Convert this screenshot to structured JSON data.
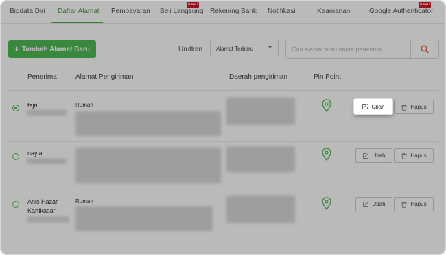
{
  "tabs": [
    {
      "label": "Biodata Diri",
      "active": false
    },
    {
      "label": "Daftar Alamat",
      "active": true
    },
    {
      "label": "Pembayaran",
      "active": false
    },
    {
      "label": "Beli Langsung",
      "active": false,
      "badge": "BARU"
    },
    {
      "label": "Rekening Bank",
      "active": false
    },
    {
      "label": "Notifikasi",
      "active": false
    },
    {
      "label": "Keamanan",
      "active": false
    },
    {
      "label": "Google Authenticator",
      "active": false,
      "badge": "BARU"
    }
  ],
  "toolbar": {
    "add_label": "Tambah Alamat Baru",
    "sort_label": "Urutkan",
    "sort_value": "Alamat Terbaru",
    "search_placeholder": "Cari alamat atau nama penerima"
  },
  "table": {
    "headers": [
      "Penerima",
      "Alamat Pengiriman",
      "Daerah pengiriman",
      "Pin Point"
    ],
    "rows": [
      {
        "name": "fajri",
        "address_label": "Rumah",
        "selected": true
      },
      {
        "name": "nayla",
        "address_label": "",
        "selected": false
      },
      {
        "name": "Anis Hazar Kartikasari",
        "address_label": "Rumah",
        "selected": false
      }
    ]
  },
  "actions": {
    "edit_label": "Ubah",
    "delete_label": "Hapus"
  },
  "colors": {
    "accent": "#42b549",
    "badge": "#d0021b"
  }
}
